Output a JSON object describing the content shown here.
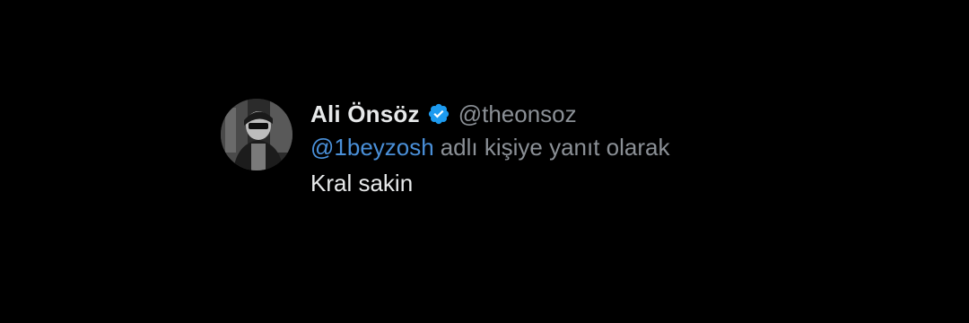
{
  "tweet": {
    "author": {
      "display_name": "Ali Önsöz",
      "handle": "@theonsoz",
      "verified": true,
      "verified_icon": "verified-badge-icon",
      "verified_color": "#1d9bf0",
      "avatar": "profile-avatar"
    },
    "reply_context": {
      "mention": "@1beyzosh",
      "text": "adlı kişiye yanıt olarak"
    },
    "body": "Kral sakin"
  },
  "colors": {
    "background": "#000000",
    "primary_text": "#e7e9ea",
    "secondary_text": "#8b9096",
    "mention": "#4a90d9"
  }
}
